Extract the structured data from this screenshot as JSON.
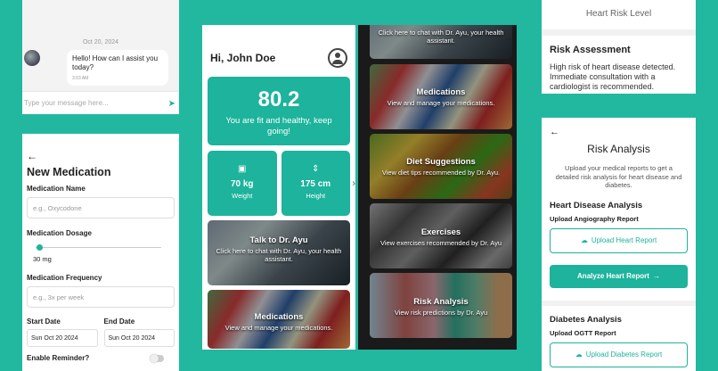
{
  "chat": {
    "date": "Oct 20, 2024",
    "message": "Hello! How can I assist you today?",
    "time": "3:03 AM",
    "input_placeholder": "Type your message here..."
  },
  "medication": {
    "back": "←",
    "title": "New Medication",
    "name_label": "Medication Name",
    "name_placeholder": "e.g., Oxycodone",
    "dosage_label": "Medication Dosage",
    "dosage_value": "30 mg",
    "frequency_label": "Medication Frequency",
    "frequency_placeholder": "e.g., 3x per week",
    "start_label": "Start Date",
    "start_value": "Sun Oct 20 2024",
    "end_label": "End Date",
    "end_value": "Sun Oct 20 2024",
    "reminder_label": "Enable Reminder?"
  },
  "home": {
    "greeting": "Hi, John Doe",
    "score": "80.2",
    "score_message": "You are fit and healthy, keep going!",
    "weight_value": "70 kg",
    "weight_label": "Weight",
    "height_value": "175 cm",
    "height_label": "Height",
    "tiles": [
      {
        "title": "Talk to Dr. Ayu",
        "subtitle": "Click here to chat with Dr. Ayu, your health assistant."
      },
      {
        "title": "Medications",
        "subtitle": "View and manage your medications."
      }
    ]
  },
  "dark_tiles": [
    {
      "title": "",
      "subtitle": "Click here to chat with Dr. Ayu, your health assistant."
    },
    {
      "title": "Medications",
      "subtitle": "View and manage your medications."
    },
    {
      "title": "Diet Suggestions",
      "subtitle": "View diet tips recommended by Dr. Ayu."
    },
    {
      "title": "Exercises",
      "subtitle": "View exercises recommended by Dr. Ayu"
    },
    {
      "title": "Risk Analysis",
      "subtitle": "View risk predictions by Dr. Ayu"
    }
  ],
  "risk_top": {
    "level_label": "Heart Risk Level",
    "assessment_title": "Risk Assessment",
    "assessment_text": "High risk of heart disease detected. Immediate consultation with a cardiologist is recommended."
  },
  "analysis": {
    "back": "←",
    "title": "Risk Analysis",
    "intro": "Upload your medical reports to get a detailed risk analysis for heart disease and diabetes.",
    "heart_title": "Heart Disease Analysis",
    "heart_sub": "Upload Angiography Report",
    "heart_upload": "Upload Heart Report",
    "analyze_heart": "Analyze Heart Report",
    "diabetes_title": "Diabetes Analysis",
    "diabetes_sub": "Upload OGTT Report",
    "diabetes_upload": "Upload Diabetes Report"
  },
  "colors": {
    "background": "#22b8a0",
    "accent": "#1db39c"
  }
}
